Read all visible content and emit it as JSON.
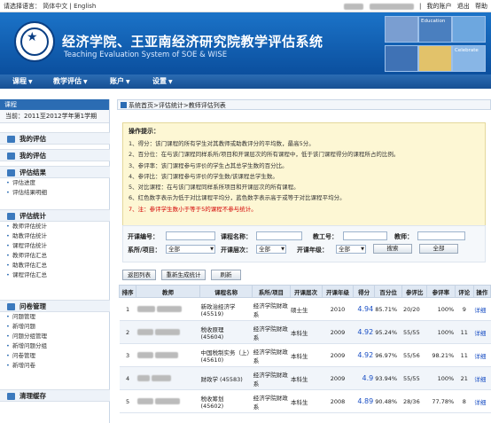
{
  "topbar": {
    "lang_label": "请选择语言：",
    "lang_cn": "简体中文",
    "lang_sep": "|",
    "lang_en": "English",
    "account_sep": "|",
    "my_account": "我的账户",
    "logout": "退出",
    "help": "帮助"
  },
  "header": {
    "title_cn": "经济学院、王亚南经济研究院教学评估系统",
    "title_en": "Teaching Evaluation System of SOE & WISE",
    "deco_labels": [
      "",
      "Education",
      "",
      "",
      "",
      "Celebrate"
    ]
  },
  "nav": {
    "items": [
      {
        "label": "课程"
      },
      {
        "label": "教学评估"
      },
      {
        "label": "账户"
      },
      {
        "label": "设置"
      }
    ]
  },
  "sidebar": {
    "heading": "课程",
    "term": "当前：2011至2012学年第1学期",
    "groups": [
      {
        "title": "我的评估",
        "subs": []
      },
      {
        "title": "我的评估",
        "subs": []
      },
      {
        "title": "评估结果",
        "subs": [
          "评估进度",
          "评估结果明细"
        ]
      },
      {
        "title": "评估统计",
        "subs": [
          "教师评估统计",
          "助教评估统计",
          "课程评估统计",
          "教师评估汇总",
          "助教评估汇总",
          "课程评估汇总"
        ]
      },
      {
        "title": "问卷管理",
        "subs": [
          "问题管理",
          "新增问题",
          "问题分组管理",
          "新增问题分组",
          "问卷管理",
          "新增问卷"
        ]
      },
      {
        "title": "清理缓存",
        "subs": []
      }
    ]
  },
  "breadcrumb": "系统首页>评估统计>教师评估列表",
  "tips": {
    "title": "操作提示：",
    "lines": [
      "1、得分：该门课程的所有学生对其教师或助教评分的平均数，最高5分。",
      "2、百分位：在与该门课程同样系所/项目和开课层次的所有课程中，低于该门课程得分的课程所占的比例。",
      "3、参评率：该门课程参与评价的学生占其总学生数的百分比。",
      "4、参评比：该门课程参与评价的学生数/该课程总学生数。",
      "5、对比课程：在与该门课程同样系所项目和开课层次的所有课程。",
      "6、红色数字表示为低于对比课程平均分，蓝色数字表示高于或等于对比课程平均分。",
      "7、注：参评学生数小于等于5的课程不参与统计。"
    ]
  },
  "search": {
    "course_no_label": "开课编号：",
    "course_name_label": "课程名称：",
    "teacher_no_label": "教工号：",
    "teacher_label": "教师：",
    "dept_label": "系所/项目：",
    "dept_value": "全部",
    "level_label": "开课层次：",
    "level_value": "全部",
    "year_label": "开课年级：",
    "year_value": "全部",
    "search_btn": "搜索",
    "all_btn": "全部"
  },
  "actions": {
    "back": "返回列表",
    "regen": "重新生成统计",
    "refresh": "刷新"
  },
  "table": {
    "headers": [
      "排序",
      "教师",
      "课程名称",
      "系所/项目",
      "开课层次",
      "开课年级",
      "得分",
      "百分位",
      "参评比",
      "参评率",
      "评论",
      "操作"
    ],
    "rows": [
      {
        "rank": "1",
        "course": "新政治经济学",
        "code": "(45519)",
        "dept": "经济学院财政系",
        "level": "硕士生",
        "year": "2010",
        "score": "4.94",
        "pct": "85.71%",
        "ratio": "20/20",
        "rate": "100%",
        "comments": "9",
        "op": "详细"
      },
      {
        "rank": "2",
        "course": "税收原理",
        "code": "(45604)",
        "dept": "经济学院财政系",
        "level": "本科生",
        "year": "2009",
        "score": "4.92",
        "pct": "95.24%",
        "ratio": "55/55",
        "rate": "100%",
        "comments": "11",
        "op": "详细"
      },
      {
        "rank": "3",
        "course": "中国税制实务（上）",
        "code": "(45610)",
        "dept": "经济学院财政系",
        "level": "本科生",
        "year": "2009",
        "score": "4.92",
        "pct": "96.97%",
        "ratio": "55/56",
        "rate": "98.21%",
        "comments": "11",
        "op": "详细"
      },
      {
        "rank": "4",
        "course": "财政学",
        "code": "(45583)",
        "dept": "经济学院财政系",
        "level": "本科生",
        "year": "2009",
        "score": "4.9",
        "pct": "93.94%",
        "ratio": "55/55",
        "rate": "100%",
        "comments": "21",
        "op": "详细"
      },
      {
        "rank": "5",
        "course": "税收筹划",
        "code": "(45602)",
        "dept": "经济学院财政系",
        "level": "本科生",
        "year": "2008",
        "score": "4.89",
        "pct": "90.48%",
        "ratio": "28/36",
        "rate": "77.78%",
        "comments": "8",
        "op": "详细"
      }
    ]
  }
}
